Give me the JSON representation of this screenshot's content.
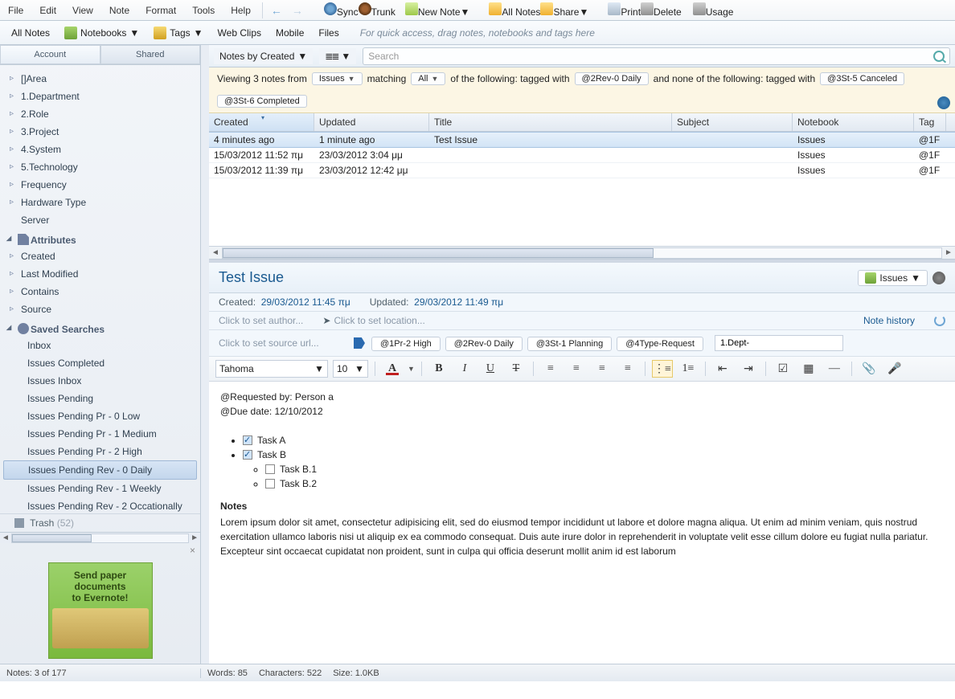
{
  "menu": {
    "file": "File",
    "edit": "Edit",
    "view": "View",
    "note": "Note",
    "format": "Format",
    "tools": "Tools",
    "help": "Help"
  },
  "maintb": {
    "sync": "Sync",
    "trunk": "Trunk",
    "newnote": "New Note",
    "allnotes": "All Notes",
    "share": "Share",
    "print": "Print",
    "delete": "Delete",
    "usage": "Usage"
  },
  "tb2": {
    "allnotes": "All Notes",
    "notebooks": "Notebooks",
    "tags": "Tags",
    "webclips": "Web Clips",
    "mobile": "Mobile",
    "files": "Files",
    "hint": "For quick access, drag notes, notebooks and tags here"
  },
  "sidebar": {
    "tabs": {
      "account": "Account",
      "shared": "Shared"
    },
    "tree": [
      {
        "label": "[]Area"
      },
      {
        "label": "1.Department"
      },
      {
        "label": "2.Role"
      },
      {
        "label": "3.Project"
      },
      {
        "label": "4.System"
      },
      {
        "label": "5.Technology"
      },
      {
        "label": "Frequency"
      },
      {
        "label": "Hardware Type"
      },
      {
        "label": "Server",
        "leaf": true
      }
    ],
    "attributes_head": "Attributes",
    "attributes": [
      {
        "label": "Created"
      },
      {
        "label": "Last Modified"
      },
      {
        "label": "Contains"
      },
      {
        "label": "Source"
      }
    ],
    "saved_head": "Saved Searches",
    "saved": [
      {
        "label": "Inbox"
      },
      {
        "label": "Issues Completed"
      },
      {
        "label": "Issues Inbox"
      },
      {
        "label": "Issues Pending"
      },
      {
        "label": "Issues Pending Pr - 0 Low"
      },
      {
        "label": "Issues Pending Pr - 1 Medium"
      },
      {
        "label": "Issues Pending Pr - 2 High"
      },
      {
        "label": "Issues Pending Rev - 0 Daily",
        "selected": true
      },
      {
        "label": "Issues Pending Rev - 1 Weekly"
      },
      {
        "label": "Issues Pending Rev - 2 Occationally"
      }
    ],
    "trash": {
      "label": "Trash",
      "count": "(52)"
    },
    "promo": {
      "l1": "Send paper",
      "l2": "documents",
      "l3": "to Evernote!"
    }
  },
  "viewbar": {
    "notesby": "Notes by Created",
    "search_placeholder": "Search"
  },
  "filter": {
    "t1": "Viewing 3 notes from",
    "nb": "Issues",
    "t2": "matching",
    "all": "All",
    "t3": "of the following:  tagged with",
    "tag1": "@2Rev-0 Daily",
    "t4": "and none of the following:  tagged with",
    "tag2": "@3St-5 Canceled",
    "tag3": "@3St-6 Completed"
  },
  "columns": {
    "created": "Created",
    "updated": "Updated",
    "title": "Title",
    "subject": "Subject",
    "notebook": "Notebook",
    "tag": "Tag"
  },
  "rows": [
    {
      "created": "4 minutes ago",
      "updated": "1 minute ago",
      "title": "Test Issue",
      "subject": "",
      "notebook": "Issues",
      "tag": "@1F",
      "sel": true
    },
    {
      "created": "15/03/2012 11:52 πμ",
      "updated": "23/03/2012 3:04 μμ",
      "title": "",
      "subject": "",
      "notebook": "Issues",
      "tag": "@1F"
    },
    {
      "created": "15/03/2012 11:39 πμ",
      "updated": "23/03/2012 12:42 μμ",
      "title": "",
      "subject": "",
      "notebook": "Issues",
      "tag": "@1F"
    }
  ],
  "editor": {
    "title": "Test Issue",
    "notebook": "Issues",
    "created_lbl": "Created:",
    "created": "29/03/2012 11:45 πμ",
    "updated_lbl": "Updated:",
    "updated": "29/03/2012 11:49 πμ",
    "author_hint": "Click to set author...",
    "location_hint": "Click to set location...",
    "history": "Note history",
    "url_hint": "Click to set source url...",
    "tags": [
      "@1Pr-2 High",
      "@2Rev-0 Daily",
      "@3St-1 Planning",
      "@4Type-Request"
    ],
    "tag_input": "1.Dept-",
    "font": "Tahoma",
    "size": "10",
    "body": {
      "l1": "@Requested by: Person a",
      "l2": "@Due date: 12/10/2012",
      "taskA": "Task A",
      "taskB": "Task B",
      "taskB1": "Task B.1",
      "taskB2": "Task B.2",
      "notes_h": "Notes",
      "notes_p": "Lorem ipsum dolor sit amet, consectetur adipisicing elit, sed do eiusmod tempor incididunt ut labore et dolore magna aliqua. Ut enim ad minim veniam, quis nostrud exercitation ullamco laboris nisi ut aliquip ex ea commodo consequat. Duis aute irure dolor in reprehenderit in voluptate velit esse cillum dolore eu fugiat nulla pariatur. Excepteur sint occaecat cupidatat non proident, sunt in culpa qui officia deserunt mollit anim id est laborum"
    }
  },
  "status": {
    "left": "Notes: 3 of 177",
    "words": "Words: 85",
    "chars": "Characters: 522",
    "size": "Size: 1.0KB"
  }
}
